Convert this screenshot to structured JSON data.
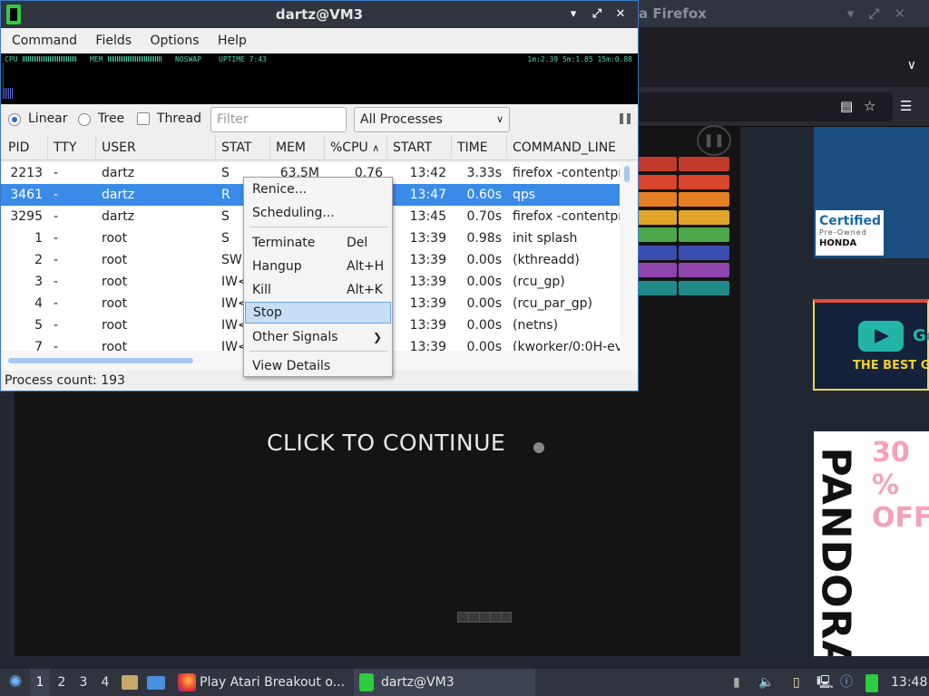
{
  "firefox": {
    "title": "a Firefox",
    "ad_certified": "Certified",
    "ad_preowned": "Pre-Owned",
    "ad_honda": "HONDA",
    "ad_g": "Go",
    "ad_best": "THE BEST GA",
    "ad_pandora": "PANDORA",
    "ad_off": "30 % OFF"
  },
  "game": {
    "message": "CLICK TO CONTINUE"
  },
  "qps": {
    "title": "dartz@VM3",
    "menu": [
      "Command",
      "Fields",
      "Options",
      "Help"
    ],
    "monitor": {
      "cpu": "CPU",
      "mem": "MEM",
      "noswap": "NOSWAP",
      "uptime": "UPTIME 7:43",
      "load": "1m:2.39 5m:1.85 15m:0.88"
    },
    "view_linear": "Linear",
    "view_tree": "Tree",
    "thread_label": "Thread",
    "filter_placeholder": "Filter",
    "process_filter": "All Processes",
    "columns": [
      "PID",
      "TTY",
      "USER",
      "STAT",
      "MEM",
      "%CPU",
      "START",
      "TIME",
      "COMMAND_LINE"
    ],
    "rows": [
      {
        "pid": "2213",
        "tty": "-",
        "user": "dartz",
        "stat": "S",
        "mem": "63.5M",
        "cpu": "0.76",
        "start": "13:42",
        "time": "3.33s",
        "cmd": "firefox -contentpr"
      },
      {
        "pid": "3461",
        "tty": "-",
        "user": "dartz",
        "stat": "R",
        "mem": "",
        "cpu": "",
        "start": "13:47",
        "time": "0.60s",
        "cmd": "qps"
      },
      {
        "pid": "3295",
        "tty": "-",
        "user": "dartz",
        "stat": "S",
        "mem": "",
        "cpu": "",
        "start": "13:45",
        "time": "0.70s",
        "cmd": "firefox -contentpr"
      },
      {
        "pid": "1",
        "tty": "-",
        "user": "root",
        "stat": "S",
        "mem": "",
        "cpu": "",
        "start": "13:39",
        "time": "0.98s",
        "cmd": "init splash"
      },
      {
        "pid": "2",
        "tty": "-",
        "user": "root",
        "stat": "SW",
        "mem": "",
        "cpu": "",
        "start": "13:39",
        "time": "0.00s",
        "cmd": "(kthreadd)"
      },
      {
        "pid": "3",
        "tty": "-",
        "user": "root",
        "stat": "IW<",
        "mem": "",
        "cpu": "",
        "start": "13:39",
        "time": "0.00s",
        "cmd": "(rcu_gp)"
      },
      {
        "pid": "4",
        "tty": "-",
        "user": "root",
        "stat": "IW<",
        "mem": "",
        "cpu": "",
        "start": "13:39",
        "time": "0.00s",
        "cmd": "(rcu_par_gp)"
      },
      {
        "pid": "5",
        "tty": "-",
        "user": "root",
        "stat": "IW<",
        "mem": "",
        "cpu": "",
        "start": "13:39",
        "time": "0.00s",
        "cmd": "(netns)"
      },
      {
        "pid": "7",
        "tty": "-",
        "user": "root",
        "stat": "IW<",
        "mem": "",
        "cpu": "",
        "start": "13:39",
        "time": "0.00s",
        "cmd": "(kworker/0:0H-ev"
      }
    ],
    "status": "Process count: 193"
  },
  "context_menu": [
    {
      "label": "Renice...",
      "shortcut": ""
    },
    {
      "label": "Scheduling...",
      "shortcut": ""
    },
    {
      "label": "Terminate",
      "shortcut": "Del"
    },
    {
      "label": "Hangup",
      "shortcut": "Alt+H"
    },
    {
      "label": "Kill",
      "shortcut": "Alt+K"
    },
    {
      "label": "Stop",
      "shortcut": ""
    },
    {
      "label": "Other Signals",
      "shortcut": ""
    },
    {
      "label": "View Details",
      "shortcut": ""
    }
  ],
  "taskbar": {
    "workspaces": [
      "1",
      "2",
      "3",
      "4"
    ],
    "tasks": [
      "Play Atari Breakout o...",
      "dartz@VM3"
    ],
    "clock": "13:48"
  }
}
